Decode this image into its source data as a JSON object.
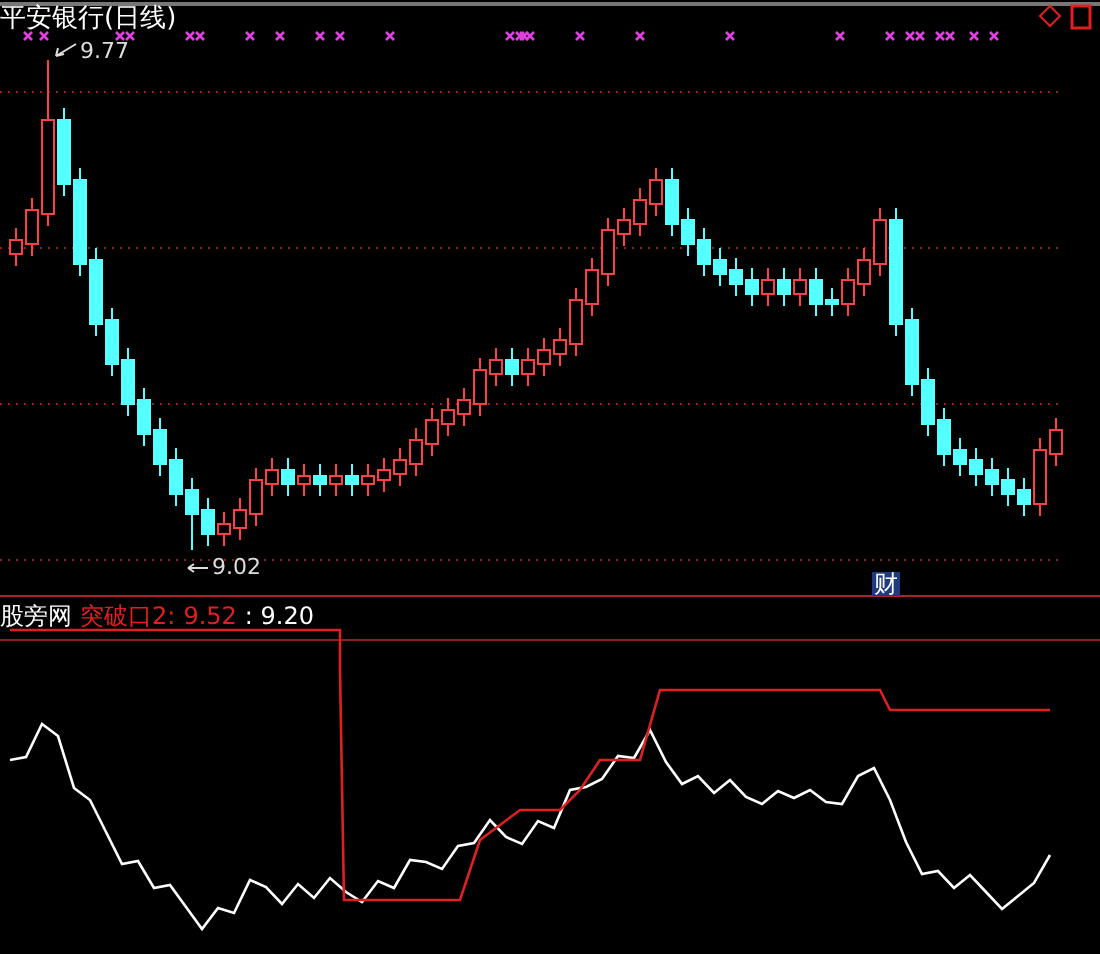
{
  "title": "平安银行(日线)",
  "high_label": "9.77",
  "low_label": "9.02",
  "finance_badge": "财",
  "indicator": {
    "name": "股旁网",
    "line_label": "突破口2:",
    "line_value": "9.52",
    "second_value": ": 9.20"
  }
}
